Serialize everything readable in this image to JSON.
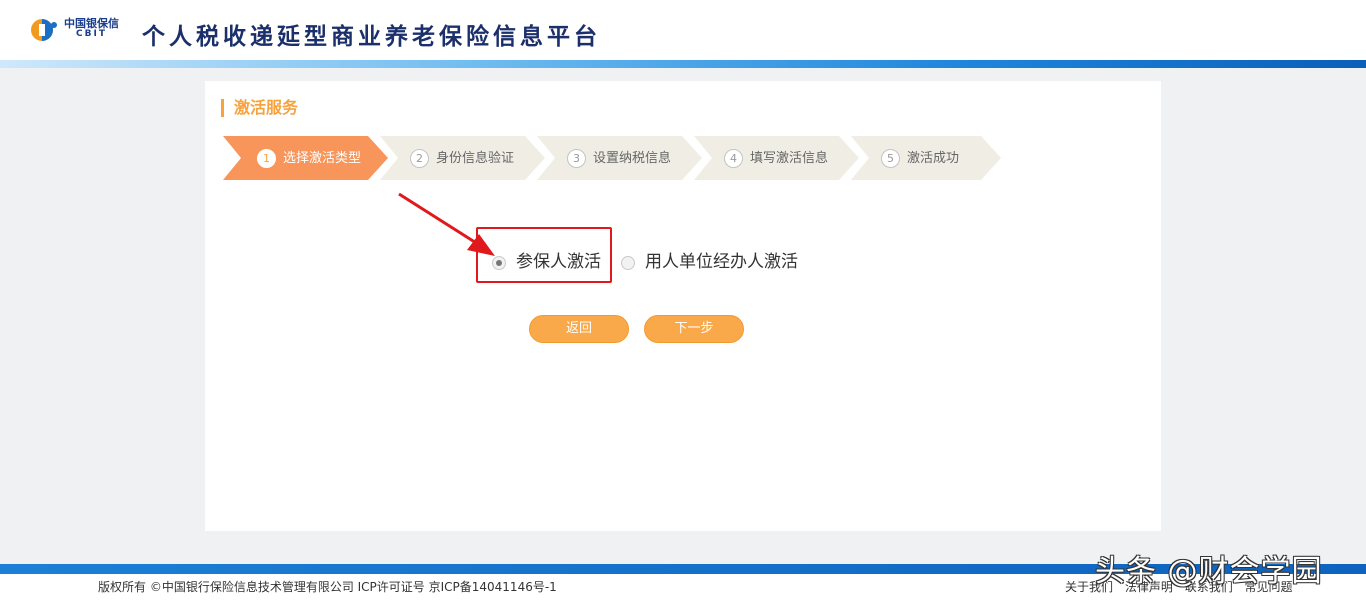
{
  "header": {
    "logo_cn": "中国银保信",
    "logo_en": "CBIT",
    "title": "个人税收递延型商业养老保险信息平台"
  },
  "panel": {
    "section_title": "激活服务",
    "steps": [
      {
        "num": "1",
        "label": "选择激活类型",
        "active": true
      },
      {
        "num": "2",
        "label": "身份信息验证",
        "active": false
      },
      {
        "num": "3",
        "label": "设置纳税信息",
        "active": false
      },
      {
        "num": "4",
        "label": "填写激活信息",
        "active": false
      },
      {
        "num": "5",
        "label": "激活成功",
        "active": false
      }
    ],
    "options": [
      {
        "label": "参保人激活",
        "checked": true
      },
      {
        "label": "用人单位经办人激活",
        "checked": false
      }
    ],
    "buttons": {
      "back": "返回",
      "next": "下一步"
    }
  },
  "footer": {
    "copyright": "版权所有 ©中国银行保险信息技术管理有限公司 ICP许可证号 京ICP备14041146号-1",
    "links": [
      "关于我们",
      "法律声明",
      "联系我们",
      "常见问题"
    ]
  },
  "watermark": "头条 @财会学园",
  "colors": {
    "accent": "#f7a23e",
    "step_inactive": "#efede4",
    "highlight": "#e0191c",
    "title": "#1b2f6b"
  }
}
